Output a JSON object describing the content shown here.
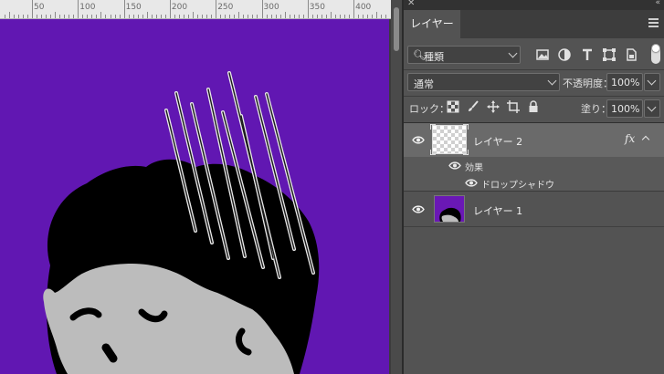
{
  "ruler": {
    "labels": [
      "50",
      "100",
      "150",
      "200",
      "250",
      "300",
      "350",
      "400"
    ]
  },
  "canvas": {
    "background": "#6117b2",
    "hair": "#000000",
    "face": "#bcbcbc"
  },
  "panel": {
    "title": "レイヤー",
    "filter": {
      "label": "種類",
      "icons": [
        "image-filter-icon",
        "adjustment-filter-icon",
        "type-filter-icon",
        "shape-filter-icon",
        "smart-object-filter-icon"
      ]
    },
    "blend_mode": "通常",
    "opacity_label": "不透明度：",
    "opacity_value": "100%",
    "lock_label": "ロック：",
    "fill_label": "塗り：",
    "fill_value": "100%",
    "layers": [
      {
        "name": "レイヤー 2",
        "fx": "fx",
        "effects_label": "効果",
        "effect": "ドロップシャドウ"
      },
      {
        "name": "レイヤー 1"
      }
    ]
  }
}
